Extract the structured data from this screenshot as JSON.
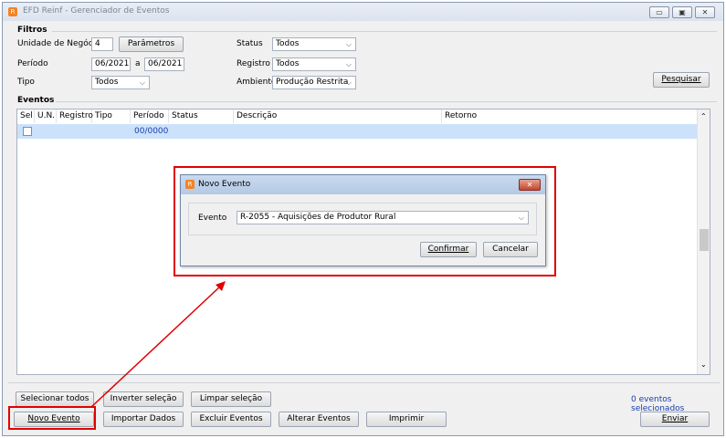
{
  "window": {
    "title": "EFD Reinf - Gerenciador de Eventos"
  },
  "filtros": {
    "section_label": "Filtros",
    "unidade_label": "Unidade de Negócio",
    "unidade_value": "4",
    "parametros_label": "Parâmetros",
    "periodo_label": "Período",
    "periodo_from": "06/2021",
    "periodo_sep": "a",
    "periodo_to": "06/2021",
    "tipo_label": "Tipo",
    "tipo_value": "Todos",
    "status_label": "Status",
    "status_value": "Todos",
    "registro_label": "Registro",
    "registro_value": "Todos",
    "ambiente_label": "Ambiente",
    "ambiente_value": "Produção Restrita",
    "pesquisar_label": "Pesquisar"
  },
  "eventos": {
    "section_label": "Eventos",
    "columns": [
      "Sel",
      "U.N.",
      "Registro",
      "Tipo",
      "Período",
      "Status",
      "Descrição",
      "Retorno"
    ],
    "rows": [
      {
        "periodo": "00/0000"
      }
    ]
  },
  "dialog": {
    "title": "Novo Evento",
    "evento_label": "Evento",
    "evento_value": "R-2055 - Aquisições de Produtor Rural",
    "confirmar_label": "Confirmar",
    "cancelar_label": "Cancelar"
  },
  "footer": {
    "selecionar_todos": "Selecionar todos",
    "inverter_selecao": "Inverter seleção",
    "limpar_selecao": "Limpar seleção",
    "selected_count": "0 eventos selecionados",
    "novo_evento": "Novo Evento",
    "importar_dados": "Importar Dados",
    "excluir_eventos": "Excluir Eventos",
    "alterar_eventos": "Alterar Eventos",
    "imprimir": "Imprimir",
    "enviar": "Enviar"
  },
  "colors": {
    "highlight": "#e00000",
    "selected_row": "#cce2fb",
    "link_text": "#1a3da8"
  }
}
